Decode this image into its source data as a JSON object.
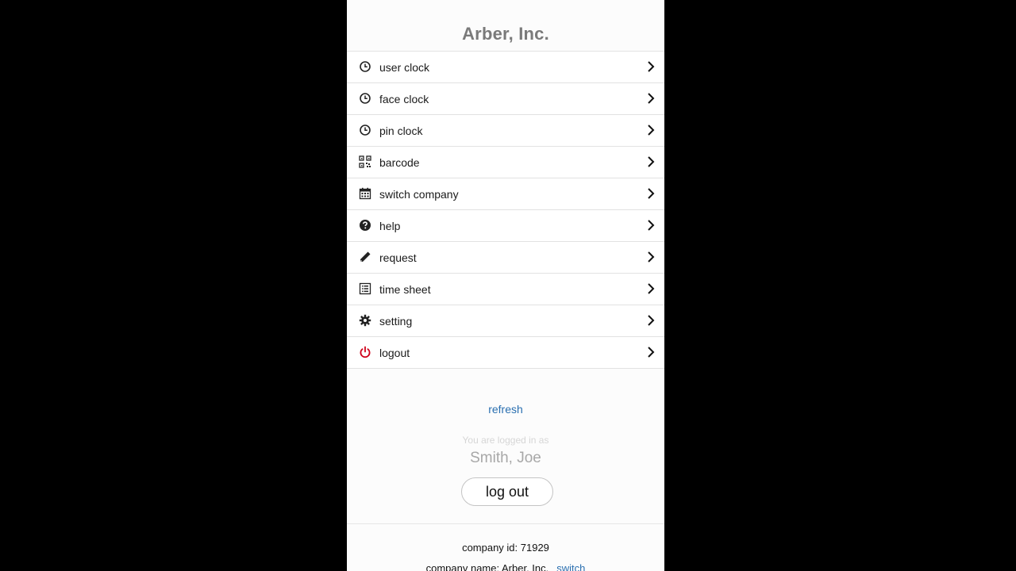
{
  "header": {
    "company_title": "Arber, Inc."
  },
  "menu": {
    "items": [
      {
        "label": "user clock",
        "icon": "clock-icon"
      },
      {
        "label": "face clock",
        "icon": "clock-icon"
      },
      {
        "label": "pin clock",
        "icon": "clock-icon"
      },
      {
        "label": "barcode",
        "icon": "qr-code-icon"
      },
      {
        "label": "switch company",
        "icon": "calendar-icon"
      },
      {
        "label": "help",
        "icon": "question-circle-icon"
      },
      {
        "label": "request",
        "icon": "pencil-icon"
      },
      {
        "label": "time sheet",
        "icon": "list-icon"
      },
      {
        "label": "setting",
        "icon": "gear-icon"
      },
      {
        "label": "logout",
        "icon": "power-icon"
      }
    ]
  },
  "session": {
    "refresh_label": "refresh",
    "logged_in_caption": "You are logged in as",
    "user_name": "Smith, Joe",
    "logout_button": "log out"
  },
  "footer": {
    "company_id": "company id: 71929",
    "company_name": "company name: Arber, Inc.",
    "switch_label": "switch"
  },
  "colors": {
    "page_bg": "#fcfcfc",
    "title": "#7a7a7a",
    "link": "#2a6fb0",
    "power_icon": "#d0021b"
  }
}
